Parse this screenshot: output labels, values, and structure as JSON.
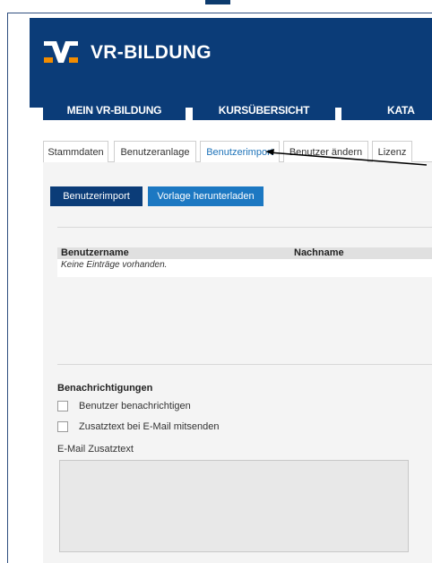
{
  "header": {
    "brand": "VR-BILDUNG"
  },
  "nav": {
    "items": [
      "MEIN VR-BILDUNG",
      "KURSÜBERSICHT",
      "KATA"
    ]
  },
  "tabs": [
    {
      "label": "Stammdaten"
    },
    {
      "label": "Benutzeranlage"
    },
    {
      "label": "Benutzerimport",
      "active": true
    },
    {
      "label": "Benutzer ändern"
    },
    {
      "label": "Lizenz"
    }
  ],
  "actions": {
    "import_label": "Benutzerimport",
    "template_label": "Vorlage herunterladen"
  },
  "table": {
    "columns": [
      "Benutzername",
      "Nachname"
    ],
    "empty_text": "Keine Einträge vorhanden."
  },
  "notifications": {
    "title": "Benachrichtigungen",
    "options": [
      {
        "label": "Benutzer benachrichtigen",
        "checked": false
      },
      {
        "label": "Zusatztext bei E-Mail mitsenden",
        "checked": false
      }
    ],
    "email_text_label": "E-Mail Zusatztext",
    "email_text_value": ""
  },
  "colors": {
    "primary": "#0b3c78",
    "accent": "#1c78c2",
    "active_tab": "#1e73b9"
  }
}
